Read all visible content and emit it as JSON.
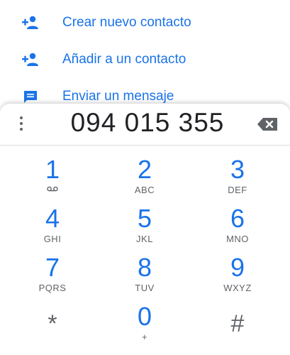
{
  "actions": [
    {
      "label": "Crear nuevo contacto",
      "icon": "add-person-icon"
    },
    {
      "label": "Añadir a un contacto",
      "icon": "add-person-icon"
    },
    {
      "label": "Enviar un mensaje",
      "icon": "message-icon"
    }
  ],
  "dialer": {
    "number": "094 015 355",
    "menu_icon": "more-vert-icon",
    "backspace_icon": "backspace-icon"
  },
  "keypad": [
    {
      "digit": "1",
      "letters": "",
      "voicemail_icon": "voicemail-icon"
    },
    {
      "digit": "2",
      "letters": "ABC"
    },
    {
      "digit": "3",
      "letters": "DEF"
    },
    {
      "digit": "4",
      "letters": "GHI"
    },
    {
      "digit": "5",
      "letters": "JKL"
    },
    {
      "digit": "6",
      "letters": "MNO"
    },
    {
      "digit": "7",
      "letters": "PQRS"
    },
    {
      "digit": "8",
      "letters": "TUV"
    },
    {
      "digit": "9",
      "letters": "WXYZ"
    },
    {
      "digit": "*",
      "letters": ""
    },
    {
      "digit": "0",
      "letters": "+"
    },
    {
      "digit": "#",
      "letters": ""
    }
  ],
  "colors": {
    "accent": "#1a73e8",
    "text": "#202124",
    "secondary": "#5f6368"
  }
}
